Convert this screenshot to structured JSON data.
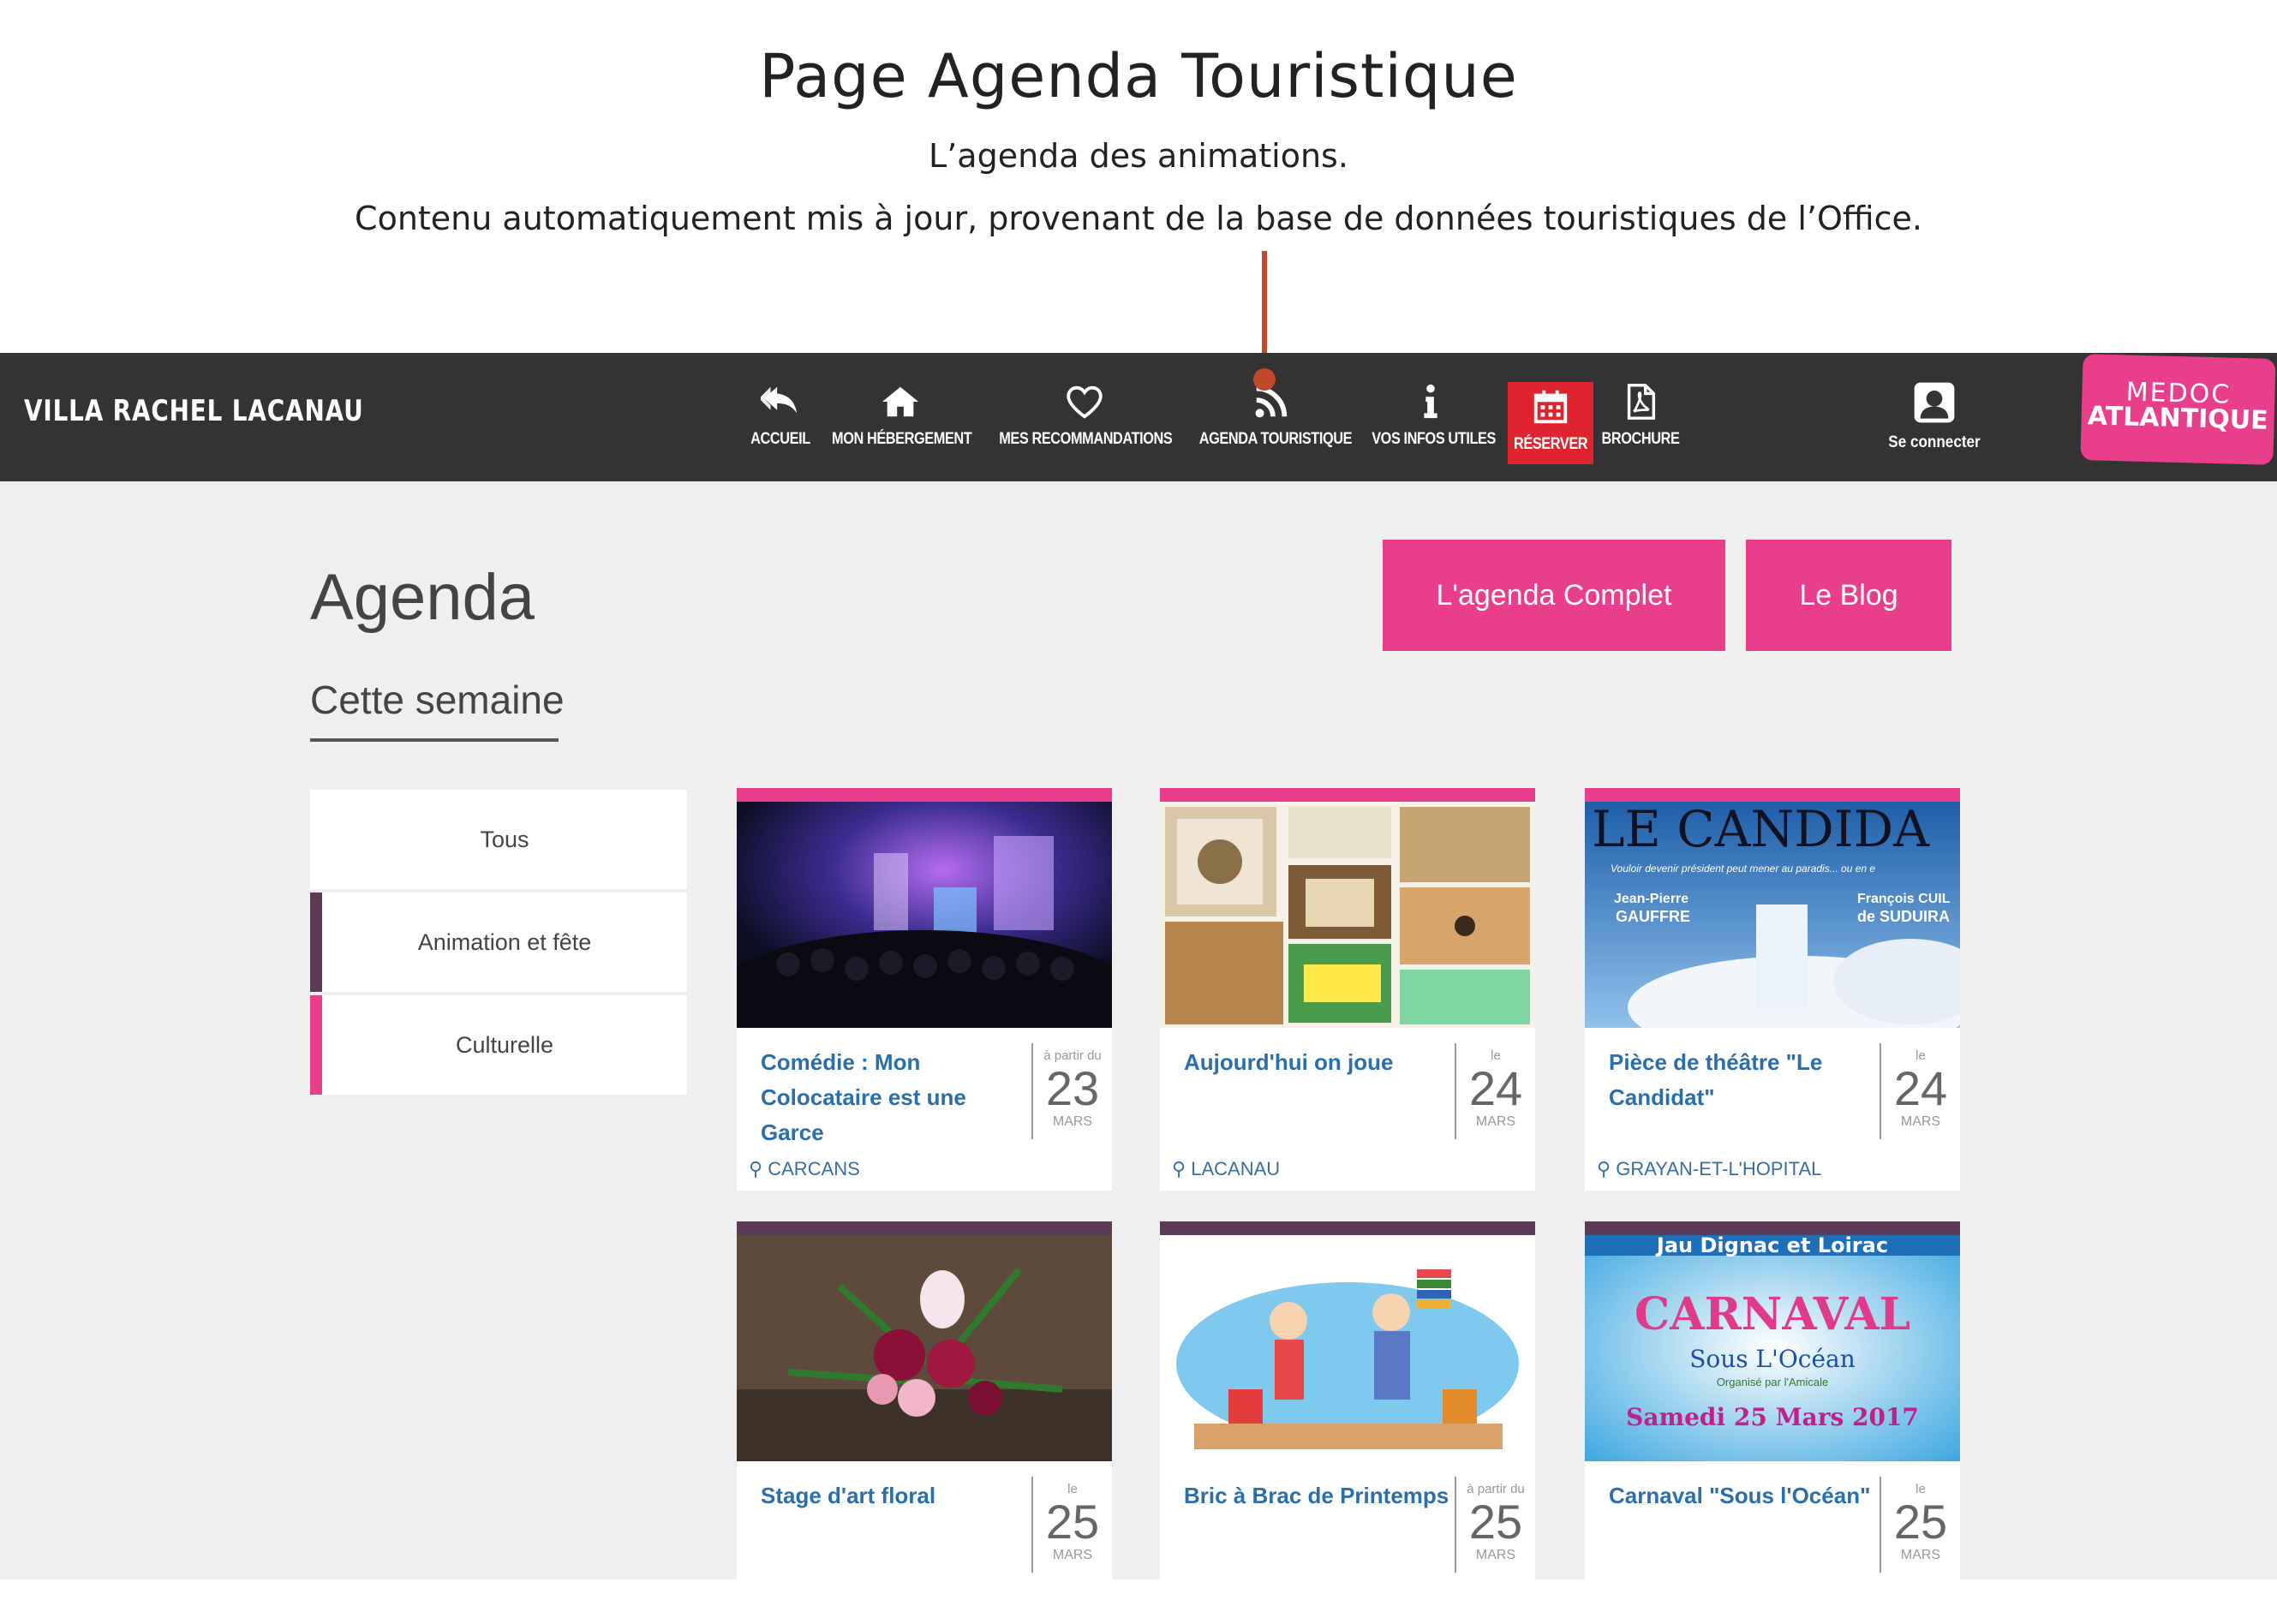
{
  "annotation": {
    "title": "Page Agenda Touristique",
    "line1": "L’agenda des animations.",
    "line2": "Contenu automatiquement mis à jour, provenant de la base de données touristiques de l’Office."
  },
  "nav": {
    "brand": "VILLA RACHEL LACANAU",
    "items": [
      {
        "label": "ACCUEIL",
        "icon": "reply-icon"
      },
      {
        "label": "MON HÉBERGEMENT",
        "icon": "home-icon"
      },
      {
        "label": "MES RECOMMANDATIONS",
        "icon": "heart-icon"
      },
      {
        "label": "AGENDA TOURISTIQUE",
        "icon": "rss-icon"
      },
      {
        "label": "VOS INFOS UTILES",
        "icon": "info-icon"
      },
      {
        "label": "RÉSERVER",
        "icon": "calendar-icon"
      },
      {
        "label": "BROCHURE",
        "icon": "pdf-icon"
      }
    ],
    "login": "Se connecter",
    "logo_line1": "MEDOC",
    "logo_line2": "ATLANTIQUE",
    "colors": {
      "bar": "#333333",
      "active": "#e0242f",
      "logo": "#e83e8c"
    }
  },
  "main": {
    "title": "Agenda",
    "week_tab": "Cette semaine",
    "btn_full": "L'agenda Complet",
    "btn_blog": "Le Blog",
    "filters": [
      "Tous",
      "Animation et fête",
      "Culturelle"
    ],
    "cards": [
      {
        "title": "Comédie : Mon Colocataire est une Garce",
        "pre": "à partir du",
        "day": "23",
        "month": "MARS",
        "place": "CARCANS"
      },
      {
        "title": "Aujourd'hui on joue",
        "pre": "le",
        "day": "24",
        "month": "MARS",
        "place": "LACANAU"
      },
      {
        "title": "Pièce de théâtre \"Le Candidat\"",
        "pre": "le",
        "day": "24",
        "month": "MARS",
        "place": "GRAYAN-ET-L'HOPITAL"
      },
      {
        "title": "Stage d'art floral",
        "pre": "le",
        "day": "25",
        "month": "MARS",
        "place": ""
      },
      {
        "title": "Bric à Brac de Printemps",
        "pre": "à partir du",
        "day": "25",
        "month": "MARS",
        "place": ""
      },
      {
        "title": "Carnaval \"Sous l'Océan\"",
        "pre": "le",
        "day": "25",
        "month": "MARS",
        "place": ""
      }
    ],
    "poster_text": {
      "candidat_title": "LE CANDIDA",
      "candidat_sub": "Vouloir devenir président peut mener au paradis... ou en e",
      "candidat_actor": "Jean-Pierre",
      "candidat_actor2": "GAUFFRE",
      "candidat_actor3": "François CUIL",
      "candidat_actor4": "de SUDUIRA",
      "carnaval_top": "Jau Dignac et Loirac",
      "carnaval_word": "CARNAVAL",
      "carnaval_sous": "Sous L'Océan",
      "carnaval_org": "Organisé par l'Amicale",
      "carnaval_date": "Samedi 25 Mars 2017"
    }
  }
}
